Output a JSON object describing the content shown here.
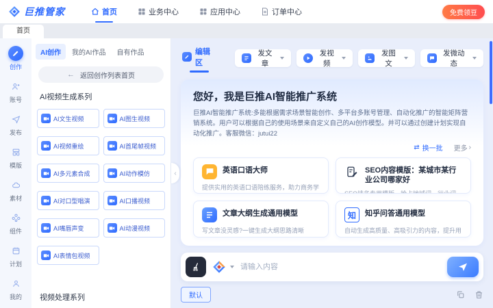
{
  "colors": {
    "primary": "#2F6BFF",
    "badge_start": "#FF7A45",
    "badge_end": "#FF4D4F",
    "main_bg": "#E9EEFB"
  },
  "icons": {
    "back_arrow": "←",
    "swap": "⇄",
    "chevron_right": "›",
    "collapse": "‹",
    "zhihu_glyph": "知"
  },
  "navbar": {
    "logo": "巨推管家",
    "items": [
      {
        "label": "首页"
      },
      {
        "label": "业务中心"
      },
      {
        "label": "应用中心"
      },
      {
        "label": "订单中心"
      }
    ],
    "badge": "免费领豆"
  },
  "tabbar": {
    "active_tab": "首页"
  },
  "rail": {
    "items": [
      {
        "label": "创作"
      },
      {
        "label": "账号"
      },
      {
        "label": "发布"
      },
      {
        "label": "模版"
      },
      {
        "label": "素材"
      },
      {
        "label": "组件"
      },
      {
        "label": "计划"
      },
      {
        "label": "我的"
      }
    ]
  },
  "sidebar": {
    "tabs": [
      {
        "label": "AI创作"
      },
      {
        "label": "我的AI作品"
      },
      {
        "label": "自有作品"
      }
    ],
    "back_label": "返回创作列表首页",
    "section_title": "AI视频生成系列",
    "tools": [
      "AI文生视频",
      "AI图生视频",
      "AI视频重绘",
      "AI首尾帧视频",
      "AI多元素合成",
      "AI动作模仿",
      "AI对口型唱演",
      "AI口播视频",
      "AI嘴唇声变",
      "AI动漫视频",
      "AI表情包视频"
    ],
    "bottom_section_title": "视频处理系列"
  },
  "main": {
    "edit_tab": "编辑区",
    "publish_actions": [
      {
        "label": "发文章"
      },
      {
        "label": "发视频"
      },
      {
        "label": "发图文"
      },
      {
        "label": "发微动态"
      }
    ],
    "hero": {
      "title": "您好，我是巨推AI智能推广系统",
      "description": "巨推AI智能推广系统:多能根据需求场景智能创作、多平台多账号管理、自动化推广的智能矩阵营销系统。用户可以根据自己的使用场景来自定义自己的AI创作模型。并可以通过创建计划实现自动化推广。客服微信：jutui22",
      "swap_label": "换一批",
      "more_label": "更多"
    },
    "cards": [
      {
        "title": "英语口语大师",
        "desc": "提供实用的英语口语陪练服务，助力商务学习者提高口语能力"
      },
      {
        "title": "SEO内容模版：某城市某行业公司哪家好",
        "desc": "SEO排名专用模版，抢占地域词、行业词、口碑宣传。"
      },
      {
        "title": "文章大纲生成通用模型",
        "desc": "写文章没灵感?一键生成大纲思路清晰"
      },
      {
        "title": "知乎问答通用模型",
        "desc": "自动生成高质量、高吸引力的内容，提升用户阅读体验"
      }
    ],
    "input": {
      "placeholder": "请输入内容"
    },
    "footer": {
      "default_label": "默认"
    }
  }
}
